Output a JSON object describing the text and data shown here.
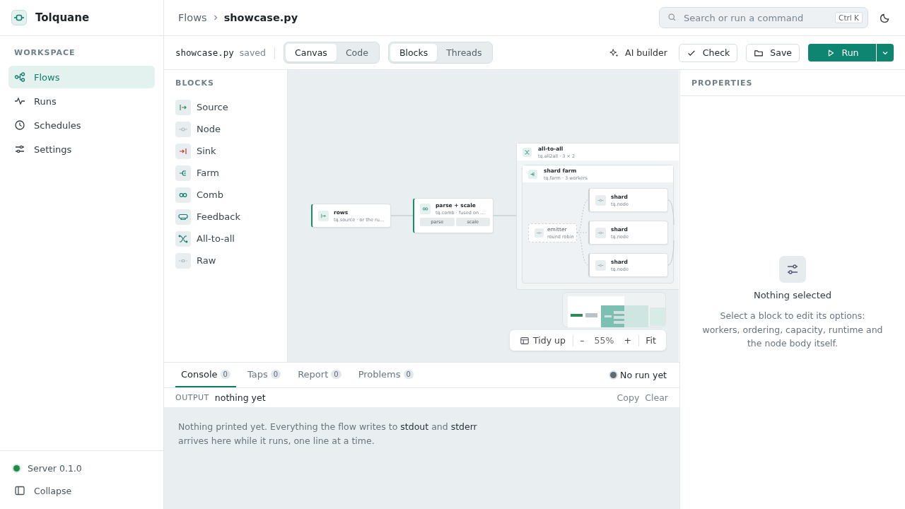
{
  "app": {
    "name": "Tolquane"
  },
  "sidebar": {
    "section": "WORKSPACE",
    "items": [
      {
        "label": "Flows",
        "kind": "flows",
        "selected": true
      },
      {
        "label": "Runs",
        "kind": "runs",
        "selected": false
      },
      {
        "label": "Schedules",
        "kind": "schedules",
        "selected": false
      },
      {
        "label": "Settings",
        "kind": "settings",
        "selected": false
      }
    ],
    "server": "Server 0.1.0",
    "collapse": "Collapse"
  },
  "breadcrumb": [
    "Flows",
    "showcase.py"
  ],
  "search": {
    "placeholder": "Search or run a command",
    "shortcut": "Ctrl K"
  },
  "toolbar": {
    "file": "showcase.py",
    "status": "saved",
    "view_tabs": [
      {
        "label": "Canvas",
        "selected": true
      },
      {
        "label": "Code",
        "selected": false
      }
    ],
    "mode_tabs": [
      {
        "label": "Blocks",
        "selected": true
      },
      {
        "label": "Threads",
        "selected": false
      }
    ],
    "ai": "AI builder",
    "check": "Check",
    "save": "Save",
    "run": "Run"
  },
  "blocks": {
    "title": "BLOCKS",
    "items": [
      {
        "label": "Source",
        "kind": "source"
      },
      {
        "label": "Node",
        "kind": "node"
      },
      {
        "label": "Sink",
        "kind": "sink"
      },
      {
        "label": "Farm",
        "kind": "farm"
      },
      {
        "label": "Comb",
        "kind": "comb"
      },
      {
        "label": "Feedback",
        "kind": "feedback"
      },
      {
        "label": "All-to-all",
        "kind": "all2all"
      },
      {
        "label": "Raw",
        "kind": "raw"
      }
    ]
  },
  "canvas": {
    "nodes": [
      {
        "kind": "source",
        "title": "rows",
        "subtitle": "tq.source · or the ru…"
      },
      {
        "kind": "comb",
        "title": "parse + scale",
        "subtitle": "tq.comb · fused on …",
        "stages": [
          "parse",
          "scale"
        ]
      },
      {
        "kind": "all2all",
        "title": "all-to-all",
        "subtitle": "tq.all2all · 3 × 2",
        "farm": {
          "title": "shard farm",
          "subtitle": "tq.farm · 3 workers",
          "emitter": {
            "title": "emitter",
            "subtitle": "round robin"
          },
          "workers": [
            {
              "title": "shard",
              "subtitle": "tq.node"
            },
            {
              "title": "shard",
              "subtitle": "tq.node"
            },
            {
              "title": "shard",
              "subtitle": "tq.node"
            }
          ]
        }
      }
    ],
    "tidy": "Tidy up",
    "zoom_out": "–",
    "zoom": "55%",
    "zoom_in": "+",
    "fit": "Fit"
  },
  "console": {
    "tabs": [
      {
        "label": "Console",
        "count": "0",
        "selected": true
      },
      {
        "label": "Taps",
        "count": "0",
        "selected": false
      },
      {
        "label": "Report",
        "count": "0",
        "selected": false
      },
      {
        "label": "Problems",
        "count": "0",
        "selected": false
      }
    ],
    "status": "No run yet",
    "output_label": "OUTPUT",
    "output_value": "nothing yet",
    "copy": "Copy",
    "clear": "Clear",
    "message": "Nothing printed yet. Everything the flow writes to **stdout** and **stderr** arrives here while it runs, one line at a time."
  },
  "properties": {
    "title": "PROPERTIES",
    "empty_title": "Nothing selected",
    "empty_text": "Select a block to edit its options: workers, ordering, capacity, runtime and the node body itself."
  }
}
